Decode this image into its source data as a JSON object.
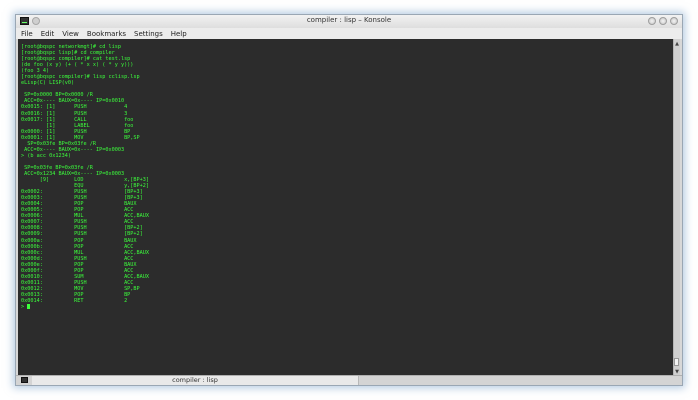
{
  "window": {
    "title": "compiler : lisp – Konsole"
  },
  "menu": [
    "File",
    "Edit",
    "View",
    "Bookmarks",
    "Settings",
    "Help"
  ],
  "terminal": {
    "lines": [
      "[root@bqspc networkmgt]# cd lisp",
      "[root@bqspc lisp]# cd compiler",
      "[root@bqspc compiler]# cat test.lsp",
      "(de foo (x y) (+ ( * x x) ( * y y)))",
      "(foo 3 4)",
      "[root@bqspc compiler]# lisp cclisp.lsp",
      "eLisp(C) LISP(v0)",
      "",
      " SP=0x0000 BP=0x0000 /R",
      " ACC=0x---- BAUX=0x---- IP=0x0010",
      "0x0015: [1]      PUSH            4",
      "0x0016: [1]      PUSH            3",
      "0x0017: [1]      CALL            foo",
      "        [1]      LABEL           foo",
      "0x0000: [1]      PUSH            BP",
      "0x0001: [1]      MOV             BP,SP",
      "  SP=0x03fe BP=0x03fe /R",
      " ACC=0x---- BAUX=0x---- IP=0x0003",
      "> (b acc 0x1234)",
      "",
      " SP=0x03fe BP=0x03fe /R",
      " ACC=0x1234 BAUX=0x---- IP=0x0003",
      "      [9]        LOD             x,[BP+3]",
      "                 EQU             y,[BP+2]",
      "0x0002:          PUSH            [BP+3]",
      "0x0003:          PUSH            [BP+3]",
      "0x0004:          POP             BAUX",
      "0x0005:          POP             ACC",
      "0x0006:          MUL             ACC,BAUX",
      "0x0007:          PUSH            ACC",
      "0x0008:          PUSH            [BP+2]",
      "0x0009:          PUSH            [BP+2]",
      "0x000a:          POP             BAUX",
      "0x000b:          POP             ACC",
      "0x000c:          MUL             ACC,BAUX",
      "0x000d:          PUSH            ACC",
      "0x000e:          POP             BAUX",
      "0x000f:          POP             ACC",
      "0x0010:          SUM             ACC,BAUX",
      "0x0011:          PUSH            ACC",
      "0x0012:          MOV             SP,BP",
      "0x0013:          POP             BP",
      "0x0014:          RET             2",
      "> "
    ]
  },
  "tabs": [
    {
      "label": "compiler : lisp"
    }
  ],
  "colors": {
    "terminal_bg": "#2c2c2c",
    "terminal_fg": "#3cff3c"
  }
}
